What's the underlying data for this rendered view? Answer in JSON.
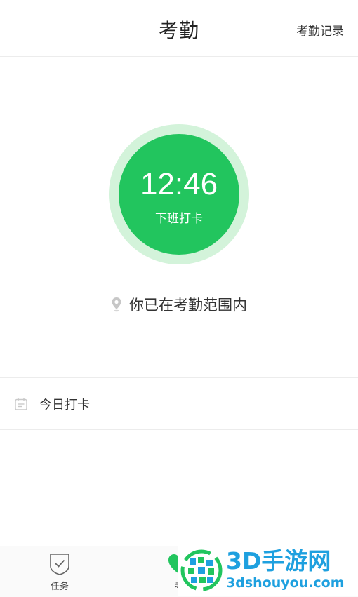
{
  "header": {
    "title": "考勤",
    "record_label": "考勤记录"
  },
  "clock": {
    "time": "12:46",
    "action_label": "下班打卡"
  },
  "location": {
    "status_text": "你已在考勤范围内",
    "icon": "location-pin-icon"
  },
  "today": {
    "label": "今日打卡",
    "icon": "calendar-icon"
  },
  "tabbar": {
    "items": [
      {
        "label": "任务",
        "icon": "shield-check-icon"
      },
      {
        "label": "考",
        "icon": "heart-icon"
      }
    ]
  },
  "watermark": {
    "brand": "3D手游网",
    "url": "3dshouyou.com"
  },
  "colors": {
    "accent_green": "#22c55e",
    "ring_green": "#d3f3da",
    "watermark_blue": "#1ea0df"
  }
}
